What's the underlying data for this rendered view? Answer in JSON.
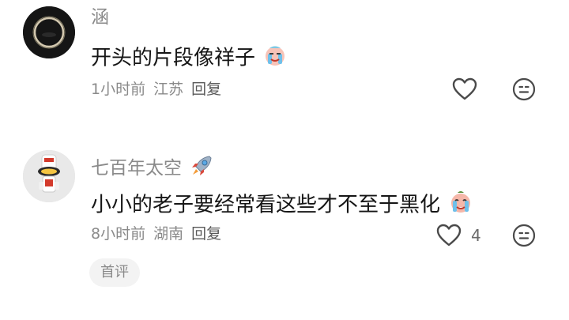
{
  "comments": [
    {
      "username": "涵",
      "content": "开头的片段像祥子",
      "content_emoji": "crying-face-emoji",
      "time": "1小时前",
      "location": "江苏",
      "reply_label": "回复",
      "like_count": ""
    },
    {
      "username": "七百年太空",
      "username_emoji": "rocket-emoji",
      "content": "小小的老子要经常看这些才不至于黑化",
      "content_emoji": "crying-face-emoji",
      "time": "8小时前",
      "location": "湖南",
      "reply_label": "回复",
      "like_count": "4"
    }
  ],
  "tag": {
    "label": "首评"
  },
  "colors": {
    "muted": "#8a8a8a",
    "text": "#161616",
    "icon": "#4a4a4a"
  }
}
